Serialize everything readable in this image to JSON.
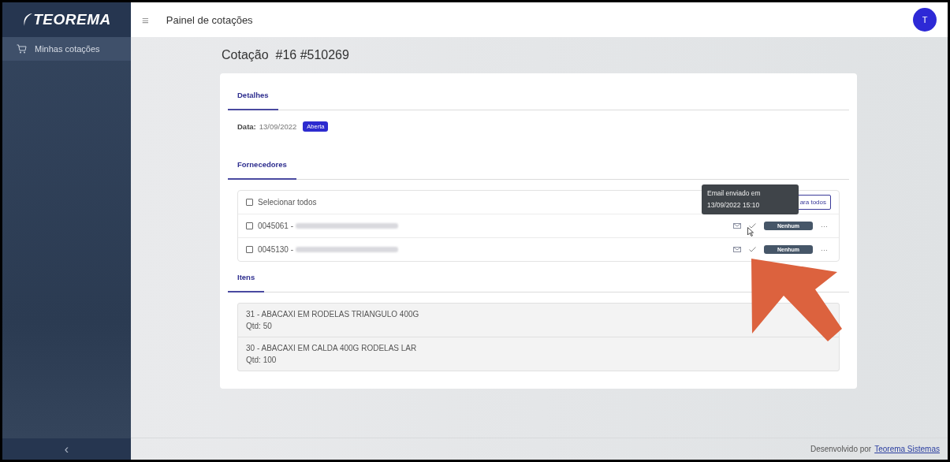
{
  "sidebar": {
    "logo": "TEOREMA",
    "items": [
      {
        "label": "Minhas cotações",
        "selected": true
      }
    ],
    "collapse": "‹"
  },
  "topbar": {
    "menu": "≡",
    "title": "Painel de cotações",
    "avatar": "T"
  },
  "page_title": "Cotação  #16 #510269",
  "details": {
    "tab": "Detalhes",
    "date_label": "Data:",
    "date": "13/09/2022",
    "status": "Aberta"
  },
  "suppliers": {
    "tab": "Fornecedores",
    "select_all": {
      "label": "Selecionar todos",
      "checked": false
    },
    "send_button": "ara todos",
    "tooltip": "Email enviado em 13/09/2022 15:10",
    "rows": [
      {
        "code": "0045061 - ",
        "checked": false,
        "status": "Nenhum",
        "more": "···"
      },
      {
        "code": "0045130 - ",
        "checked": false,
        "status": "Nenhum",
        "more": "···"
      }
    ]
  },
  "items_section": {
    "tab": "Itens",
    "items": [
      {
        "name": "31 - ABACAXI EM RODELAS TRIANGULO 400G",
        "qty": "Qtd: 50"
      },
      {
        "name": "30 - ABACAXI EM CALDA 400G RODELAS LAR",
        "qty": "Qtd: 100"
      }
    ]
  },
  "footer": {
    "text": "Desenvolvido por",
    "link": "Teorema Sistemas"
  }
}
